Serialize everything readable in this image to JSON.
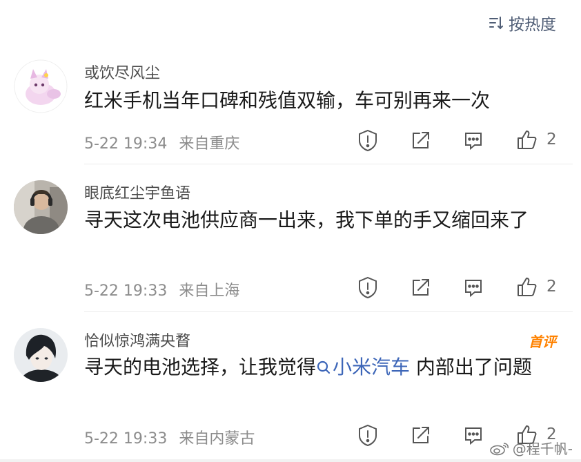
{
  "sort": {
    "label": "按热度",
    "icon": "sort-icon"
  },
  "comments": [
    {
      "username": "或饮尽风尘",
      "text": "红米手机当年口碑和残值双输，车可别再来一次",
      "time": "5-22 19:34",
      "location": "来自重庆",
      "likes": "2",
      "avatar": "fox-illustration-avatar"
    },
    {
      "username": "眼底红尘宇鱼语",
      "text": "寻天这次电池供应商一出来，我下单的手又缩回来了",
      "time": "5-22 19:33",
      "location": "来自上海",
      "likes": "2",
      "avatar": "photo-headphones-avatar"
    },
    {
      "username": "恰似惊鸿满央瞀",
      "text_before": "寻天的电池选择，让我觉得",
      "topic": "小米汽车",
      "text_after": " 内部出了问题",
      "time": "5-22 19:33",
      "location": "来自内蒙古",
      "likes": "2",
      "badge": "首评",
      "avatar": "anime-boy-avatar"
    }
  ],
  "watermark": "@程千帆-",
  "colors": {
    "link": "#3d66b8",
    "badge": "#ff8200",
    "meta": "#8c8c8c",
    "sort": "#4f5d75"
  }
}
